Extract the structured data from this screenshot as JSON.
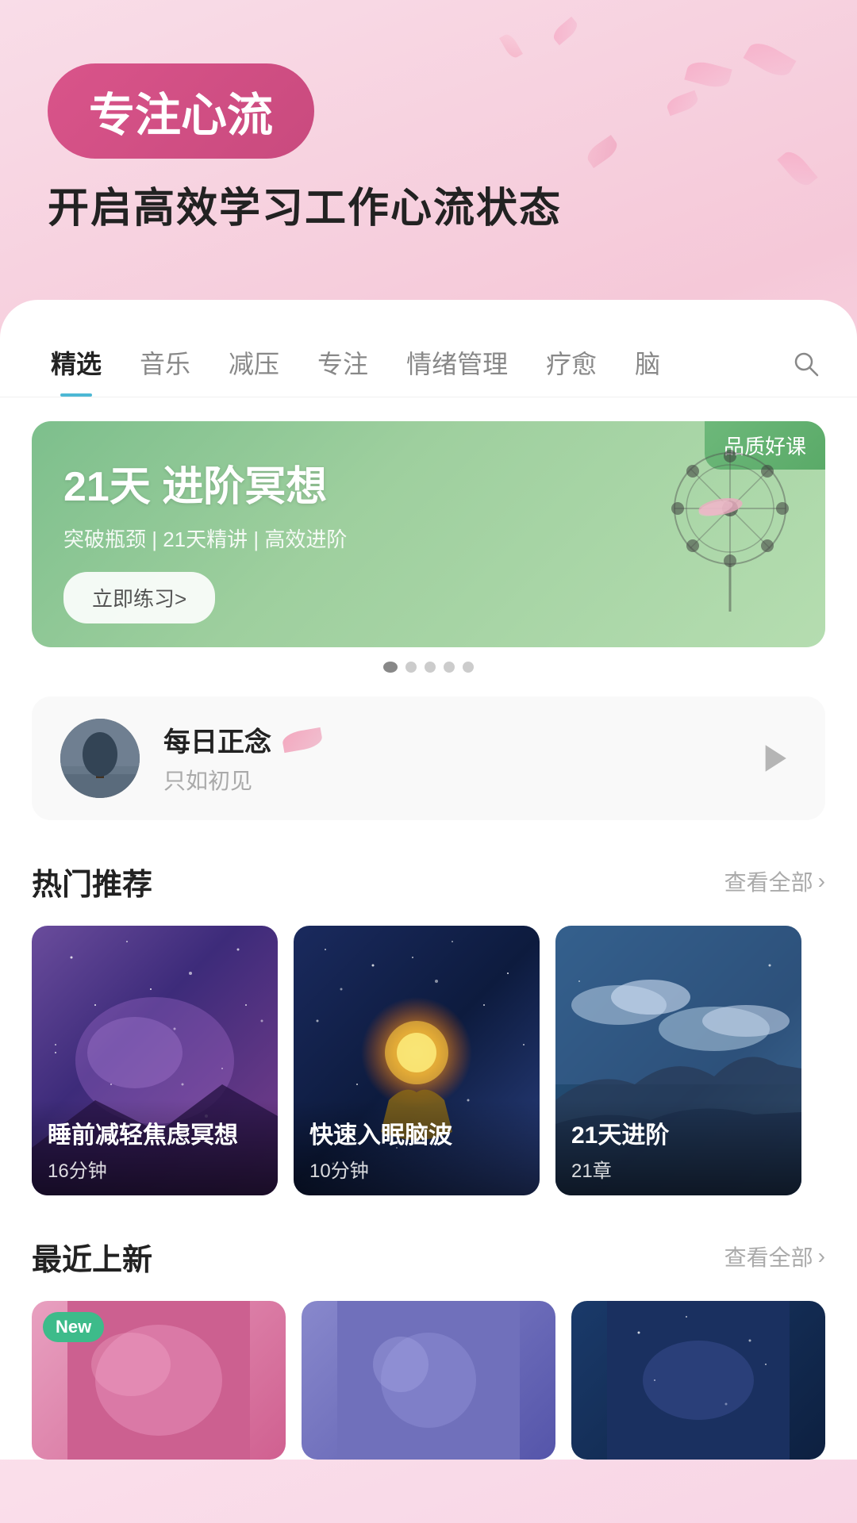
{
  "hero": {
    "badge": "专注心流",
    "subtitle": "开启高效学习工作心流状态"
  },
  "tabs": {
    "items": [
      {
        "label": "精选",
        "active": true
      },
      {
        "label": "音乐",
        "active": false
      },
      {
        "label": "减压",
        "active": false
      },
      {
        "label": "专注",
        "active": false
      },
      {
        "label": "情绪管理",
        "active": false
      },
      {
        "label": "疗愈",
        "active": false
      },
      {
        "label": "脑",
        "active": false
      }
    ]
  },
  "banner": {
    "quality_badge": "品质好课",
    "title": "21天 进阶冥想",
    "desc": "突破瓶颈 | 21天精讲 | 高效进阶",
    "btn_label": "立即练习>",
    "dots": 5
  },
  "daily": {
    "title": "每日正念",
    "subtitle": "只如初见",
    "play_label": "▷"
  },
  "hot_section": {
    "title": "热门推荐",
    "more_label": "查看全部",
    "items": [
      {
        "name": "睡前减轻焦虑冥想",
        "meta": "16分钟"
      },
      {
        "name": "快速入眠脑波",
        "meta": "10分钟"
      },
      {
        "name": "21天进阶",
        "meta": "21章"
      }
    ]
  },
  "new_section": {
    "title": "最近上新",
    "more_label": "查看全部",
    "new_badge": "New",
    "items": [
      {
        "bg": "pink"
      },
      {
        "bg": "purple"
      },
      {
        "bg": "dark-blue"
      }
    ]
  },
  "colors": {
    "accent_teal": "#4db8d4",
    "accent_pink": "#d9548a",
    "accent_green": "#7dbf8c",
    "new_badge": "#3dbb8a"
  }
}
